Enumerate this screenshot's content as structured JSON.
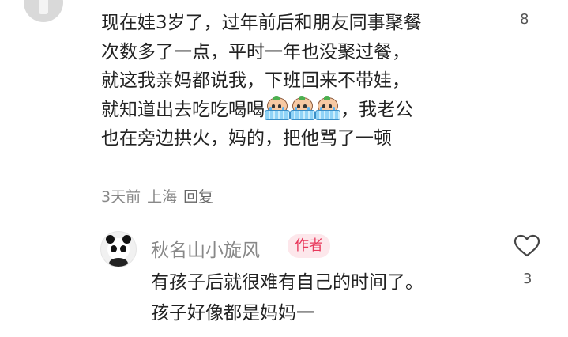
{
  "top_comment": {
    "like_count": "8",
    "lines": [
      "现在娃3岁了，过年前后和朋友同事聚餐",
      "次数多了一点，平时一年也没聚过餐，",
      "就这我亲妈都说我，下班回来不带娃，",
      "就知道出去吃吃喝喝",
      "，我老公",
      "也在旁边拱火，妈的，把他骂了一顿"
    ],
    "emoji_icon": "crying-baby-in-tub-icon",
    "time": "3天前",
    "location": "上海",
    "reply_label": "回复"
  },
  "reply": {
    "username": "秋名山小旋风",
    "badge": "作者",
    "like_count": "3",
    "lines": [
      "有孩子后就很难有自己的时间了。",
      "孩子好像都是妈妈一"
    ]
  },
  "colors": {
    "badge_text": "#e8385b",
    "badge_bg": "#fde7eb",
    "meta_text": "#888888"
  }
}
